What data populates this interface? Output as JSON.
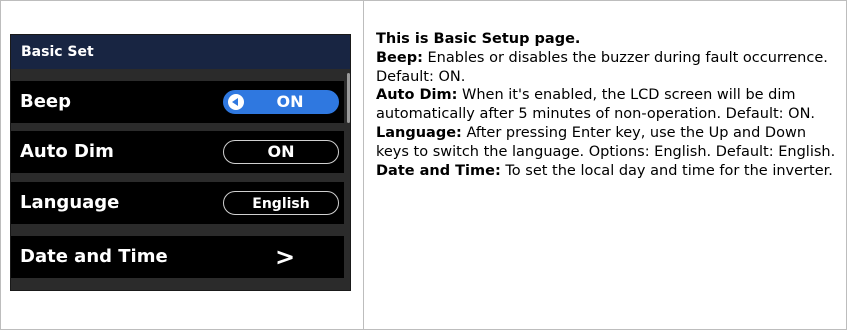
{
  "screen": {
    "title": "Basic Set",
    "rows": [
      {
        "label": "Beep",
        "value": "ON"
      },
      {
        "label": "Auto Dim",
        "value": "ON"
      },
      {
        "label": "Language",
        "value": "English"
      },
      {
        "label": "Date and Time",
        "value": ">"
      }
    ]
  },
  "description": {
    "intro": "This is Basic Setup page.",
    "items": [
      {
        "term": "Beep:",
        "text": " Enables or disables the buzzer during fault occurrence. Default: ON."
      },
      {
        "term": "Auto Dim:",
        "text": " When it's enabled, the LCD screen will be dim automatically after 5 minutes of non-operation. Default: ON."
      },
      {
        "term": "Language:",
        "text": " After pressing Enter key, use the Up and Down keys to switch the language. Options: English. Default: English."
      },
      {
        "term": "Date and Time:",
        "text": " To set the local day and time for the inverter."
      }
    ]
  },
  "colors": {
    "title_bar": "#182542",
    "toggle_active": "#2f78e0"
  },
  "icons": {
    "toggle_knob": "circle-left-arrow-icon",
    "date_time": "chevron-right-icon"
  }
}
